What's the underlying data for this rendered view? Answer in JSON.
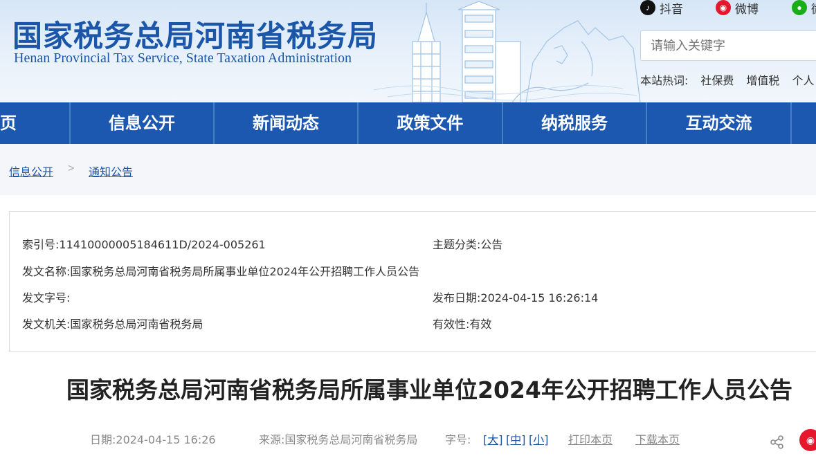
{
  "header": {
    "title": "国家税务总局河南省税务局",
    "subtitle": "Henan Provincial Tax Service, State Taxation Administration",
    "social": {
      "douyin": "抖音",
      "weibo": "微博",
      "wechat": "微"
    },
    "search_placeholder": "请输入关键字",
    "hot_label": "本站热词:",
    "hot_words": [
      "社保费",
      "增值税",
      "个人"
    ]
  },
  "nav": {
    "items": [
      "页",
      "信息公开",
      "新闻动态",
      "政策文件",
      "纳税服务",
      "互动交流"
    ]
  },
  "breadcrumb": [
    "信息公开",
    "通知公告"
  ],
  "meta": {
    "index_no": "索引号:11410000005184611D/2024-005261",
    "topic": "主题分类:公告",
    "doc_name": "发文名称:国家税务总局河南省税务局所属事业单位2024年公开招聘工作人员公告",
    "doc_no": "发文字号:",
    "publish_date": "发布日期:2024-04-15 16:26:14",
    "issuer": "发文机关:国家税务总局河南省税务局",
    "validity": "有效性:有效"
  },
  "article": {
    "title": "国家税务总局河南省税务局所属事业单位2024年公开招聘工作人员公告",
    "date": "日期:2024-04-15 16:26",
    "source": "来源:国家税务总局河南省税务局",
    "font_label": "字号:",
    "font_large": "[大]",
    "font_medium": "[中]",
    "font_small": "[小]",
    "print": "打印本页",
    "download": "下载本页"
  },
  "colors": {
    "brand": "#1b56a8",
    "nav_bg": "#1c58b0",
    "weibo": "#e6162d",
    "wechat": "#1aad19"
  }
}
